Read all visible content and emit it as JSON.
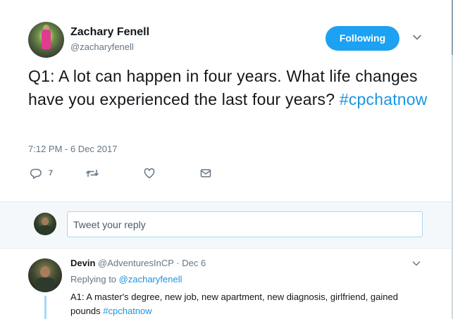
{
  "main_tweet": {
    "author_name": "Zachary Fenell",
    "author_handle": "@zacharyfenell",
    "follow_label": "Following",
    "text": "Q1: A lot can happen in four years. What life changes have you experienced the last four years?",
    "hashtag": "#cpchatnow",
    "timestamp": "7:12 PM - 6 Dec 2017",
    "reply_count": "7",
    "icons": [
      "reply-icon",
      "retweet-icon",
      "like-icon",
      "direct-message-icon",
      "chevron-down-icon"
    ]
  },
  "composer": {
    "placeholder": "Tweet your reply"
  },
  "reply_tweet": {
    "author_name": "Devin",
    "author_handle": "@AdventuresInCP",
    "separator": "·",
    "date": "Dec 6",
    "replying_prefix": "Replying to",
    "replying_to": "@zacharyfenell",
    "text": "A1: A master's degree, new job, new apartment, new diagnosis, girlfriend, gained pounds",
    "hashtag": "#cpchatnow"
  },
  "colors": {
    "accent": "#1da1f2",
    "link": "#1b95e0",
    "muted": "#657786",
    "text": "#14171a",
    "composer_bg": "#f5f8fa"
  }
}
